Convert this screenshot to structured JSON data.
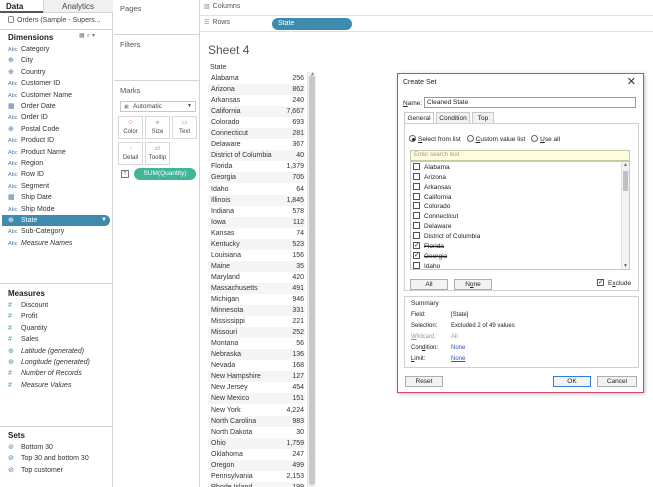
{
  "data_pane": {
    "tab_data": "Data",
    "tab_analytics": "Analytics",
    "datasource": "Orders (Sample - Supers...",
    "dimensions_header": "Dimensions",
    "dimensions": [
      {
        "label": "Category",
        "type": "Abc"
      },
      {
        "label": "City",
        "type": "globe"
      },
      {
        "label": "Country",
        "type": "globe"
      },
      {
        "label": "Customer ID",
        "type": "Abc"
      },
      {
        "label": "Customer Name",
        "type": "Abc"
      },
      {
        "label": "Order Date",
        "type": "date"
      },
      {
        "label": "Order ID",
        "type": "Abc"
      },
      {
        "label": "Postal Code",
        "type": "globe"
      },
      {
        "label": "Product ID",
        "type": "Abc"
      },
      {
        "label": "Product Name",
        "type": "Abc"
      },
      {
        "label": "Region",
        "type": "Abc"
      },
      {
        "label": "Row ID",
        "type": "Abc"
      },
      {
        "label": "Segment",
        "type": "Abc"
      },
      {
        "label": "Ship Date",
        "type": "date"
      },
      {
        "label": "Ship Mode",
        "type": "Abc"
      },
      {
        "label": "State",
        "type": "globe",
        "selected": true
      },
      {
        "label": "Sub-Category",
        "type": "Abc"
      },
      {
        "label": "Measure Names",
        "type": "Abc",
        "italic": true
      }
    ],
    "measures_header": "Measures",
    "measures": [
      {
        "label": "Discount",
        "italic": false
      },
      {
        "label": "Profit",
        "italic": false
      },
      {
        "label": "Quantity",
        "italic": false
      },
      {
        "label": "Sales",
        "italic": false
      },
      {
        "label": "Latitude (generated)",
        "italic": true
      },
      {
        "label": "Longitude (generated)",
        "italic": true
      },
      {
        "label": "Number of Records",
        "italic": true
      },
      {
        "label": "Measure Values",
        "italic": true
      }
    ],
    "sets_header": "Sets",
    "sets": [
      "Bottom 30",
      "Top 30 and bottom 30",
      "Top customer"
    ]
  },
  "cards": {
    "pages": "Pages",
    "filters": "Filters",
    "marks": "Marks",
    "marks_type": "Automatic",
    "mark_buttons": [
      {
        "label": "Color",
        "icon": "color-dots-icon"
      },
      {
        "label": "Size",
        "icon": "size-icon"
      },
      {
        "label": "Text",
        "icon": "text-icon"
      },
      {
        "label": "Detail",
        "icon": "detail-icon"
      },
      {
        "label": "Tooltip",
        "icon": "tooltip-icon"
      }
    ],
    "sum_pill": "SUM(Quantity)",
    "sum_pill_marker": "T"
  },
  "shelves": {
    "columns_label": "Columns",
    "rows_label": "Rows",
    "rows_pill": "State"
  },
  "sheet": {
    "title": "Sheet 4",
    "column_header": "State",
    "rows": [
      {
        "state": "Alabama",
        "value": "256"
      },
      {
        "state": "Arizona",
        "value": "862"
      },
      {
        "state": "Arkansas",
        "value": "240"
      },
      {
        "state": "California",
        "value": "7,667"
      },
      {
        "state": "Colorado",
        "value": "693"
      },
      {
        "state": "Connecticut",
        "value": "281"
      },
      {
        "state": "Delaware",
        "value": "367"
      },
      {
        "state": "District of Columbia",
        "value": "40"
      },
      {
        "state": "Florida",
        "value": "1,379"
      },
      {
        "state": "Georgia",
        "value": "705"
      },
      {
        "state": "Idaho",
        "value": "64"
      },
      {
        "state": "Illinois",
        "value": "1,845"
      },
      {
        "state": "Indiana",
        "value": "578"
      },
      {
        "state": "Iowa",
        "value": "112"
      },
      {
        "state": "Kansas",
        "value": "74"
      },
      {
        "state": "Kentucky",
        "value": "523"
      },
      {
        "state": "Louisiana",
        "value": "156"
      },
      {
        "state": "Maine",
        "value": "35"
      },
      {
        "state": "Maryland",
        "value": "420"
      },
      {
        "state": "Massachusetts",
        "value": "491"
      },
      {
        "state": "Michigan",
        "value": "946"
      },
      {
        "state": "Minnesota",
        "value": "331"
      },
      {
        "state": "Mississippi",
        "value": "221"
      },
      {
        "state": "Missouri",
        "value": "252"
      },
      {
        "state": "Montana",
        "value": "56"
      },
      {
        "state": "Nebraska",
        "value": "136"
      },
      {
        "state": "Nevada",
        "value": "168"
      },
      {
        "state": "New Hampshire",
        "value": "127"
      },
      {
        "state": "New Jersey",
        "value": "454"
      },
      {
        "state": "New Mexico",
        "value": "151"
      },
      {
        "state": "New York",
        "value": "4,224"
      },
      {
        "state": "North Carolina",
        "value": "983"
      },
      {
        "state": "North Dakota",
        "value": "30"
      },
      {
        "state": "Ohio",
        "value": "1,759"
      },
      {
        "state": "Oklahoma",
        "value": "247"
      },
      {
        "state": "Oregon",
        "value": "499"
      },
      {
        "state": "Pennsylvania",
        "value": "2,153"
      },
      {
        "state": "Rhode Island",
        "value": "199"
      }
    ]
  },
  "dialog": {
    "title": "Create Set",
    "close": "✕",
    "name_label_u": "N",
    "name_label_rest": "ame:",
    "name_value": "Cleaned State",
    "tabs": [
      "General",
      "Condition",
      "Top"
    ],
    "radio_select_u": "S",
    "radio_select_rest": "elect from list",
    "radio_custom_u": "C",
    "radio_custom_rest": "ustom value list",
    "radio_useall_u": "U",
    "radio_useall_rest": "se all",
    "search_placeholder": "Enter search text",
    "list_items": [
      {
        "label": "Alabama",
        "checked": false
      },
      {
        "label": "Arizona",
        "checked": false
      },
      {
        "label": "Arkansas",
        "checked": false
      },
      {
        "label": "California",
        "checked": false
      },
      {
        "label": "Colorado",
        "checked": false
      },
      {
        "label": "Connecticut",
        "checked": false
      },
      {
        "label": "Delaware",
        "checked": false
      },
      {
        "label": "District of Columbia",
        "checked": false
      },
      {
        "label": "Florida",
        "checked": true
      },
      {
        "label": "Georgia",
        "checked": true
      },
      {
        "label": "Idaho",
        "checked": false
      }
    ],
    "all_btn": "All",
    "none_btn_u": "o",
    "none_btn_pre": "N",
    "none_btn_post": "ne",
    "exclude_label_u": "x",
    "exclude_label_pre": "E",
    "exclude_label_post": "clude",
    "summary_header": "Summary",
    "summary": {
      "field_key": "Field:",
      "field_val": "[State]",
      "selection_key": "Selection:",
      "selection_val": "Excluded 2 of 49 values",
      "wildcard_key_u": "W",
      "wildcard_key_rest": "ildcard:",
      "wildcard_val": "All",
      "condition_key_u": "d",
      "condition_key_pre": "Con",
      "condition_key_post": "ition:",
      "condition_val": "None",
      "limit_key_u": "L",
      "limit_key_rest": "imit:",
      "limit_val": "None"
    },
    "reset_btn": "Reset",
    "ok_btn": "OK",
    "cancel_btn": "Cancel"
  },
  "colors": {
    "selected_field": "#3e8bad",
    "measure_pill": "#43b597",
    "dialog_border": "#d3476a",
    "link": "#1a5bd6"
  }
}
